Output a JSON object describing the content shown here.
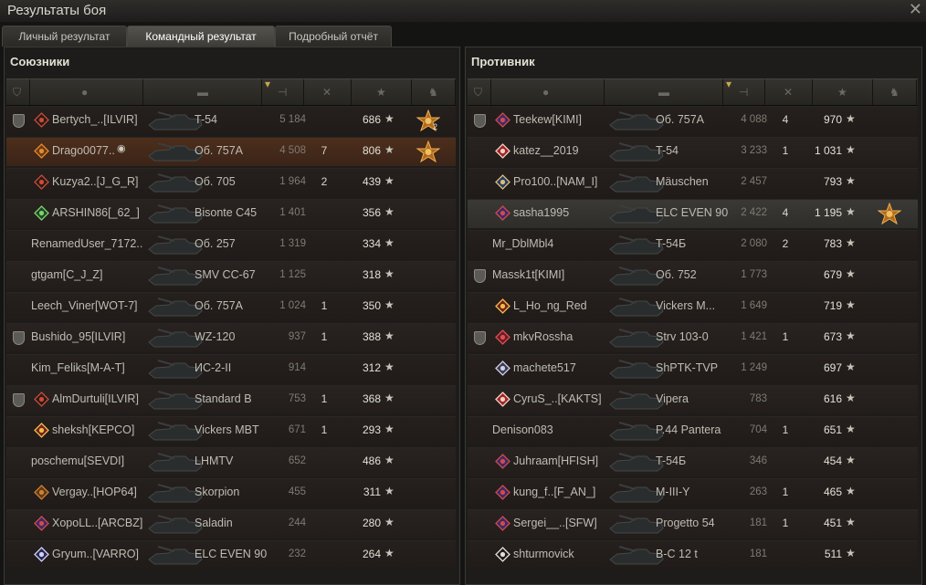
{
  "window": {
    "title": "Результаты боя"
  },
  "tabs": [
    {
      "label": "Личный результат"
    },
    {
      "label": "Командный результат"
    },
    {
      "label": "Подробный отчёт"
    }
  ],
  "allies": {
    "title": "Союзники",
    "rows": [
      {
        "name": "Bertych_..[ILVIR]",
        "tank": "T-54",
        "damage": "5 184",
        "kills": "",
        "xp": "686",
        "plate": true,
        "badge": "chevron",
        "medal": true,
        "medal_count": "2"
      },
      {
        "name": "Drago0077..",
        "tank": "Об. 757А",
        "damage": "4 508",
        "kills": "7",
        "xp": "806",
        "plate": false,
        "badge": "flame",
        "medal": true,
        "medal_count": "",
        "highlight": true
      },
      {
        "name": "Kuzya2..[J_G_R]",
        "tank": "Об. 705",
        "damage": "1 964",
        "kills": "2",
        "xp": "439",
        "plate": false,
        "badge": "chevron"
      },
      {
        "name": "ARSHIN86[_62_]",
        "tank": "Bisonte C45",
        "damage": "1 401",
        "kills": "",
        "xp": "356",
        "plate": false,
        "badge": "green"
      },
      {
        "name": "RenamedUser_7172..",
        "tank": "Об. 257",
        "damage": "1 319",
        "kills": "",
        "xp": "334",
        "plate": false
      },
      {
        "name": "gtgam[C_J_Z]",
        "tank": "SMV CC-67",
        "damage": "1 125",
        "kills": "",
        "xp": "318",
        "plate": false
      },
      {
        "name": "Leech_Viner[WOT-7]",
        "tank": "Об. 757А",
        "damage": "1 024",
        "kills": "1",
        "xp": "350",
        "plate": false
      },
      {
        "name": "Bushido_95[ILVIR]",
        "tank": "WZ-120",
        "damage": "937",
        "kills": "1",
        "xp": "388",
        "plate": true
      },
      {
        "name": "Kim_Feliks[M-A-T]",
        "tank": "ИС-2-II",
        "damage": "914",
        "kills": "",
        "xp": "312",
        "plate": false
      },
      {
        "name": "AlmDurtuli[ILVIR]",
        "tank": "Standard B",
        "damage": "753",
        "kills": "1",
        "xp": "368",
        "plate": true,
        "badge": "num2"
      },
      {
        "name": "sheksh[KEPCO]",
        "tank": "Vickers MBT",
        "damage": "671",
        "kills": "1",
        "xp": "293",
        "plate": false,
        "badge": "red"
      },
      {
        "name": "poschemu[SEVDI]",
        "tank": "LHMTV",
        "damage": "652",
        "kills": "",
        "xp": "486",
        "plate": false
      },
      {
        "name": "Vergay..[HOP64]",
        "tank": "Skorpion",
        "damage": "455",
        "kills": "",
        "xp": "311",
        "plate": false,
        "badge": "orange"
      },
      {
        "name": "XopoLL..[ARCBZ]",
        "tank": "Saladin",
        "damage": "244",
        "kills": "",
        "xp": "280",
        "plate": false,
        "badge": "purple"
      },
      {
        "name": "Gryum..[VARRO]",
        "tank": "ELC EVEN 90",
        "damage": "232",
        "kills": "",
        "xp": "264",
        "plate": false,
        "badge": "neon"
      }
    ]
  },
  "enemies": {
    "title": "Противник",
    "rows": [
      {
        "name": "Teekew[KIMI]",
        "tank": "Об. 757А",
        "damage": "4 088",
        "kills": "4",
        "xp": "970",
        "plate": true,
        "badge": "purple"
      },
      {
        "name": "katez__2019",
        "tank": "T-54",
        "damage": "3 233",
        "kills": "1",
        "xp": "1 031",
        "plate": false,
        "badge": "redflag"
      },
      {
        "name": "Pro100..[NAM_I]",
        "tank": "Mäuschen",
        "damage": "2 457",
        "kills": "",
        "xp": "793",
        "plate": false,
        "badge": "blue"
      },
      {
        "name": "sasha1995",
        "tank": "ELC EVEN 90",
        "damage": "2 422",
        "kills": "4",
        "xp": "1 195",
        "plate": false,
        "badge": "purple",
        "medal": true,
        "self": true
      },
      {
        "name": "Mr_DblMbl4",
        "tank": "T-54Б",
        "damage": "2 080",
        "kills": "2",
        "xp": "783",
        "plate": false
      },
      {
        "name": "Massk1t[KIMI]",
        "tank": "Об. 752",
        "damage": "1 773",
        "kills": "",
        "xp": "679",
        "plate": true
      },
      {
        "name": "L_Ho_ng_Red",
        "tank": "Vickers M...",
        "damage": "1 649",
        "kills": "",
        "xp": "719",
        "plate": false,
        "badge": "red"
      },
      {
        "name": "mkvRossha",
        "tank": "Strv 103-0",
        "damage": "1 421",
        "kills": "1",
        "xp": "673",
        "plate": true,
        "badge": "crimson"
      },
      {
        "name": "machete517",
        "tank": "ShPTK-TVP",
        "damage": "1 249",
        "kills": "",
        "xp": "697",
        "plate": false,
        "badge": "snow"
      },
      {
        "name": "CyruS_..[KAKTS]",
        "tank": "Vipera",
        "damage": "783",
        "kills": "",
        "xp": "616",
        "plate": false,
        "badge": "redflag"
      },
      {
        "name": "Denison083",
        "tank": "P.44 Pantera",
        "damage": "704",
        "kills": "1",
        "xp": "651",
        "plate": false
      },
      {
        "name": "Juhraam[HFISH]",
        "tank": "T-54Б",
        "damage": "346",
        "kills": "",
        "xp": "454",
        "plate": false,
        "badge": "purple"
      },
      {
        "name": "kung_f..[F_AN_]",
        "tank": "M-III-Y",
        "damage": "263",
        "kills": "1",
        "xp": "465",
        "plate": false,
        "badge": "purple"
      },
      {
        "name": "Sergei__..[SFW]",
        "tank": "Progetto 54",
        "damage": "181",
        "kills": "1",
        "xp": "451",
        "plate": false,
        "badge": "purple"
      },
      {
        "name": "shturmovick",
        "tank": "B-C 12 t",
        "damage": "181",
        "kills": "",
        "xp": "511",
        "plate": false,
        "badge": "num1"
      }
    ]
  },
  "icons": {
    "close": "close-icon",
    "star": "star-icon",
    "medal": "mastery-medal-icon",
    "platoon": "platoon-icon"
  },
  "colors": {
    "highlight_row": "#4d2e1c",
    "self_row": "#3a3935",
    "medal": "#e0a040"
  }
}
